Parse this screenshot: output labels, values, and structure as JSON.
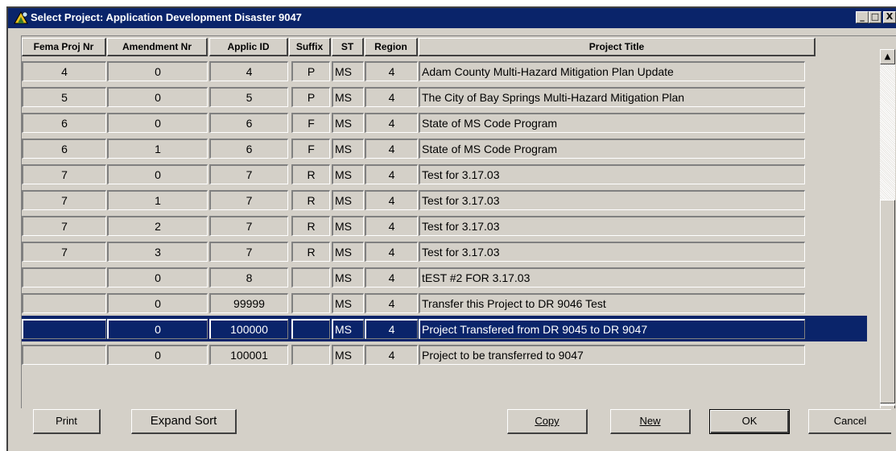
{
  "window": {
    "title": "Select Project: Application Development  Disaster 9047",
    "minimize_label": "_",
    "maximize_label": "□",
    "close_label": "X"
  },
  "columns": [
    "Fema Proj Nr",
    "Amendment Nr",
    "Applic ID",
    "Suffix",
    "ST",
    "Region",
    "Project Title"
  ],
  "rows": [
    {
      "fema": "4",
      "amend": "0",
      "applic": "4",
      "suffix": "P",
      "st": "MS",
      "region": "4",
      "title": "Adam County Multi-Hazard Mitigation Plan Update"
    },
    {
      "fema": "5",
      "amend": "0",
      "applic": "5",
      "suffix": "P",
      "st": "MS",
      "region": "4",
      "title": "The City of Bay Springs Multi-Hazard Mitigation Plan"
    },
    {
      "fema": "6",
      "amend": "0",
      "applic": "6",
      "suffix": "F",
      "st": "MS",
      "region": "4",
      "title": "State of MS Code Program"
    },
    {
      "fema": "6",
      "amend": "1",
      "applic": "6",
      "suffix": "F",
      "st": "MS",
      "region": "4",
      "title": "State of MS Code Program"
    },
    {
      "fema": "7",
      "amend": "0",
      "applic": "7",
      "suffix": "R",
      "st": "MS",
      "region": "4",
      "title": "Test for 3.17.03"
    },
    {
      "fema": "7",
      "amend": "1",
      "applic": "7",
      "suffix": "R",
      "st": "MS",
      "region": "4",
      "title": "Test for 3.17.03"
    },
    {
      "fema": "7",
      "amend": "2",
      "applic": "7",
      "suffix": "R",
      "st": "MS",
      "region": "4",
      "title": "Test for 3.17.03"
    },
    {
      "fema": "7",
      "amend": "3",
      "applic": "7",
      "suffix": "R",
      "st": "MS",
      "region": "4",
      "title": "Test for 3.17.03"
    },
    {
      "fema": "",
      "amend": "0",
      "applic": "8",
      "suffix": "",
      "st": "MS",
      "region": "4",
      "title": "tEST #2 FOR 3.17.03"
    },
    {
      "fema": "",
      "amend": "0",
      "applic": "99999",
      "suffix": "",
      "st": "MS",
      "region": "4",
      "title": "Transfer this Project to DR 9046 Test"
    },
    {
      "fema": "",
      "amend": "0",
      "applic": "100000",
      "suffix": "",
      "st": "MS",
      "region": "4",
      "title": "Project Transfered from DR 9045 to DR 9047",
      "selected": true
    },
    {
      "fema": "",
      "amend": "0",
      "applic": "100001",
      "suffix": "",
      "st": "MS",
      "region": "4",
      "title": "Project to be transferred to 9047"
    }
  ],
  "scrollbar": {
    "up_label": "▲",
    "down_label": "▼"
  },
  "buttons": {
    "print": "Print",
    "expand_sort": "Expand Sort",
    "copy": "Copy",
    "new": "New",
    "ok": "OK",
    "cancel": "Cancel"
  },
  "colors": {
    "selection": "#0a246a",
    "face": "#d4d0c8"
  }
}
